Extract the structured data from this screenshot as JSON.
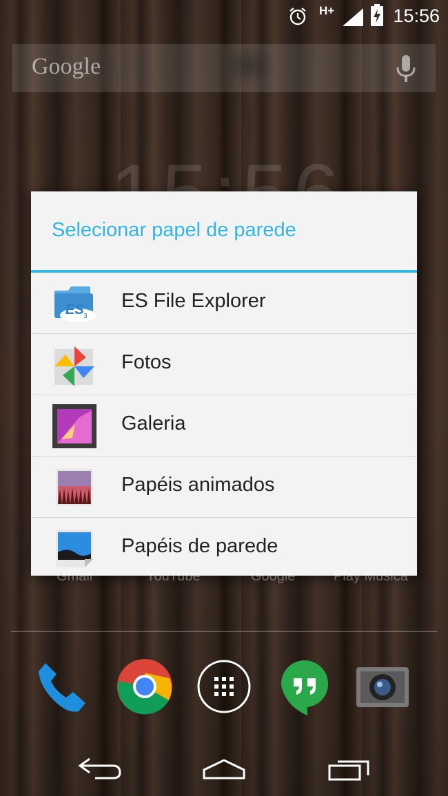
{
  "status_bar": {
    "network": "H+",
    "time": "15:56",
    "icons": [
      "alarm-icon",
      "signal-icon",
      "battery-charging-icon"
    ]
  },
  "search": {
    "logo_text": "Google",
    "icon": "mic-icon"
  },
  "background_clock": "15:56",
  "dialog": {
    "title": "Selecionar papel de parede",
    "accent_color": "#33b5e5",
    "items": [
      {
        "label": "ES File Explorer",
        "icon": "es-file-explorer-icon"
      },
      {
        "label": "Fotos",
        "icon": "fotos-pinwheel-icon"
      },
      {
        "label": "Galeria",
        "icon": "galeria-icon"
      },
      {
        "label": "Papéis animados",
        "icon": "live-wallpapers-icon"
      },
      {
        "label": "Papéis de parede",
        "icon": "wallpapers-icon"
      }
    ]
  },
  "home_labels": [
    "Gmail",
    "YouTube",
    "Google",
    "Play Música"
  ],
  "dock": [
    "phone-icon",
    "chrome-icon",
    "app-drawer-icon",
    "hangouts-icon",
    "camera-icon"
  ],
  "nav": [
    "back-icon",
    "home-icon",
    "recents-icon"
  ]
}
